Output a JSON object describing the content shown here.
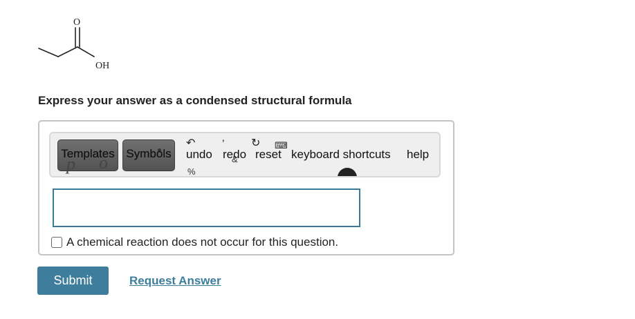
{
  "molecule": {
    "label_o": "O",
    "label_oh": "OH"
  },
  "prompt": "Express your answer as a condensed structural formula",
  "toolbar": {
    "templates_label": "Templates",
    "symbols_label": "Symbols",
    "undo_label": "undo",
    "redo_label": "redo",
    "reset_label": "reset",
    "keyboard_shortcuts_label": "keyboard shortcuts",
    "help_label": "help"
  },
  "answer_input": {
    "value": ""
  },
  "no_reaction_label": "A chemical reaction does not occur for this question.",
  "submit_label": "Submit",
  "request_answer_label": "Request Answer",
  "colors": {
    "accent": "#3e7d9c",
    "panel_border": "#c4c4c4",
    "toolbar_bg": "#efefef"
  },
  "icons": [
    "undo-icon",
    "redo-icon",
    "reset-icon",
    "keyboard-icon"
  ]
}
